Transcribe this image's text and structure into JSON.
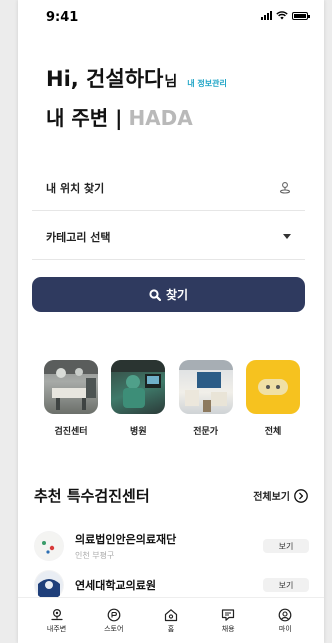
{
  "status": {
    "time": "9:41"
  },
  "greeting": {
    "name": "Hi, 건설하다",
    "suffix": "님",
    "manage_link": "내 정보관리"
  },
  "subtitle": {
    "main": "내 주변 |",
    "brand": "HADA"
  },
  "search": {
    "location_label": "내 위치 찾기",
    "category_label": "카테고리 선택",
    "button_label": "찾기"
  },
  "categories": [
    {
      "label": "검진센터"
    },
    {
      "label": "병원"
    },
    {
      "label": "전문가"
    },
    {
      "label": "전체"
    }
  ],
  "recommend": {
    "title": "추천 특수검진센터",
    "see_all": "전체보기",
    "items": [
      {
        "name": "의료법인안은의료재단",
        "location": "인천 부평구",
        "button": "보기"
      },
      {
        "name": "연세대학교의료원",
        "location": "",
        "button": "보기"
      }
    ]
  },
  "nav": [
    {
      "label": "내주변",
      "icon": "location-pin-icon"
    },
    {
      "label": "스토어",
      "icon": "store-icon"
    },
    {
      "label": "홈",
      "icon": "home-icon"
    },
    {
      "label": "채용",
      "icon": "job-icon"
    },
    {
      "label": "마이",
      "icon": "user-icon"
    }
  ]
}
